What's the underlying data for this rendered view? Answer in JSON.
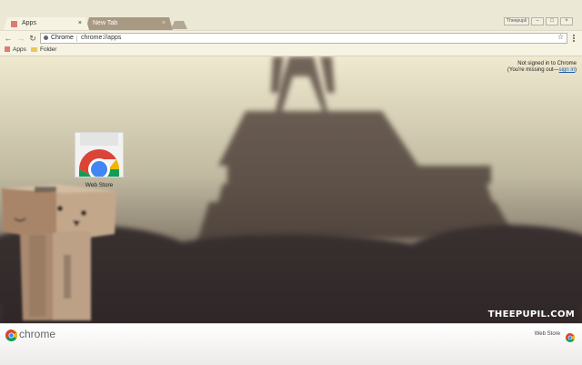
{
  "tabs": [
    {
      "label": "Apps",
      "active": true,
      "close": "×"
    },
    {
      "label": "New Tab",
      "active": false,
      "close": "×"
    }
  ],
  "window": {
    "user_badge": "Theepupil",
    "minimize": "–",
    "maximize": "□",
    "close": "×"
  },
  "toolbar": {
    "back": "←",
    "forward": "→",
    "reload": "↻",
    "chip_label": "Chrome",
    "url": "chrome://apps",
    "star": "☆"
  },
  "bookmarks": [
    {
      "label": "Apps",
      "icon": "apps-grid-icon"
    },
    {
      "label": "Folder",
      "icon": "folder-icon"
    }
  ],
  "signin": {
    "line1": "Not signed in to Chrome",
    "line2_prefix": "(You're missing out—",
    "line2_link": "sign in",
    "line2_suffix": ")"
  },
  "apps": [
    {
      "label": "Web Store",
      "icon": "chrome-web-store-icon"
    }
  ],
  "watermark": "THEEPUPIL.COM",
  "bottom_bar": {
    "wordmark": "chrome",
    "webstore_label": "Web Store"
  },
  "colors": {
    "chrome_red": "#db4437",
    "chrome_green": "#0f9d58",
    "chrome_yellow": "#f4b400",
    "chrome_blue": "#4285f4",
    "signin_link": "#1a5aa8"
  }
}
